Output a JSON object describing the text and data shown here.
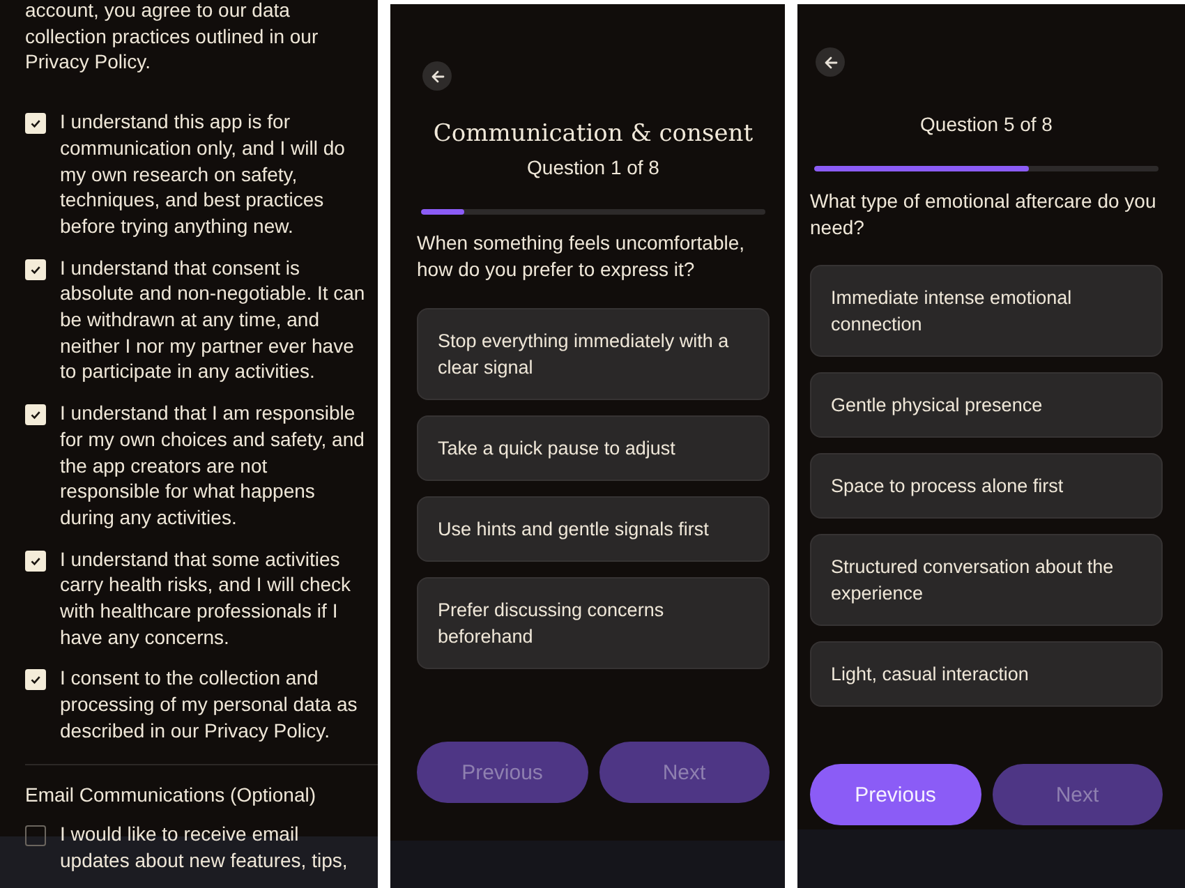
{
  "screens": [
    {
      "kind": "consent",
      "intro": "account, you agree to our data collection practices outlined in our Privacy Policy.",
      "agreements": [
        {
          "text": "I understand this app is for communication only, and I will do my own research on safety, techniques, and best practices before trying anything new.",
          "checked": true
        },
        {
          "text": "I understand that consent is absolute and non-negotiable. It can be withdrawn at any time, and neither I nor my partner ever have to participate in any activities.",
          "checked": true
        },
        {
          "text": "I understand that I am responsible for my own choices and safety, and the app creators are not responsible for what happens during any activities.",
          "checked": true
        },
        {
          "text": "I understand that some activities carry health risks, and I will check with healthcare professionals if I have any concerns.",
          "checked": true
        },
        {
          "text": "I consent to the collection and processing of my personal data as described in our Privacy Policy.",
          "checked": true
        }
      ],
      "section_title": "Email Communications (Optional)",
      "email_options": [
        {
          "text": "I would like to receive email updates about new features, tips,",
          "checked": false
        }
      ]
    },
    {
      "kind": "quiz",
      "title": "Communication & consent",
      "progress_label": "Question 1 of 8",
      "progress": {
        "level": 0.125
      },
      "question": "When something feels uncomfortable, how do you prefer to express it?",
      "options": [
        "Stop everything immediately with a clear signal",
        "Take a quick pause to adjust",
        "Use hints and gentle signals first",
        "Prefer discussing concerns beforehand"
      ],
      "buttons": [
        {
          "label": "Previous",
          "disabled": true
        },
        {
          "label": "Next",
          "disabled": true
        }
      ]
    },
    {
      "kind": "quiz",
      "progress_label": "Question 5 of 8",
      "progress": {
        "level": 0.625
      },
      "question": "What type of emotional aftercare do you need?",
      "options": [
        "Immediate intense emotional connection",
        "Gentle physical presence",
        "Space to process alone first",
        "Structured conversation about the experience",
        "Light, casual interaction"
      ],
      "buttons": [
        {
          "label": "Previous",
          "disabled": false
        },
        {
          "label": "Next",
          "disabled": true
        }
      ]
    }
  ]
}
